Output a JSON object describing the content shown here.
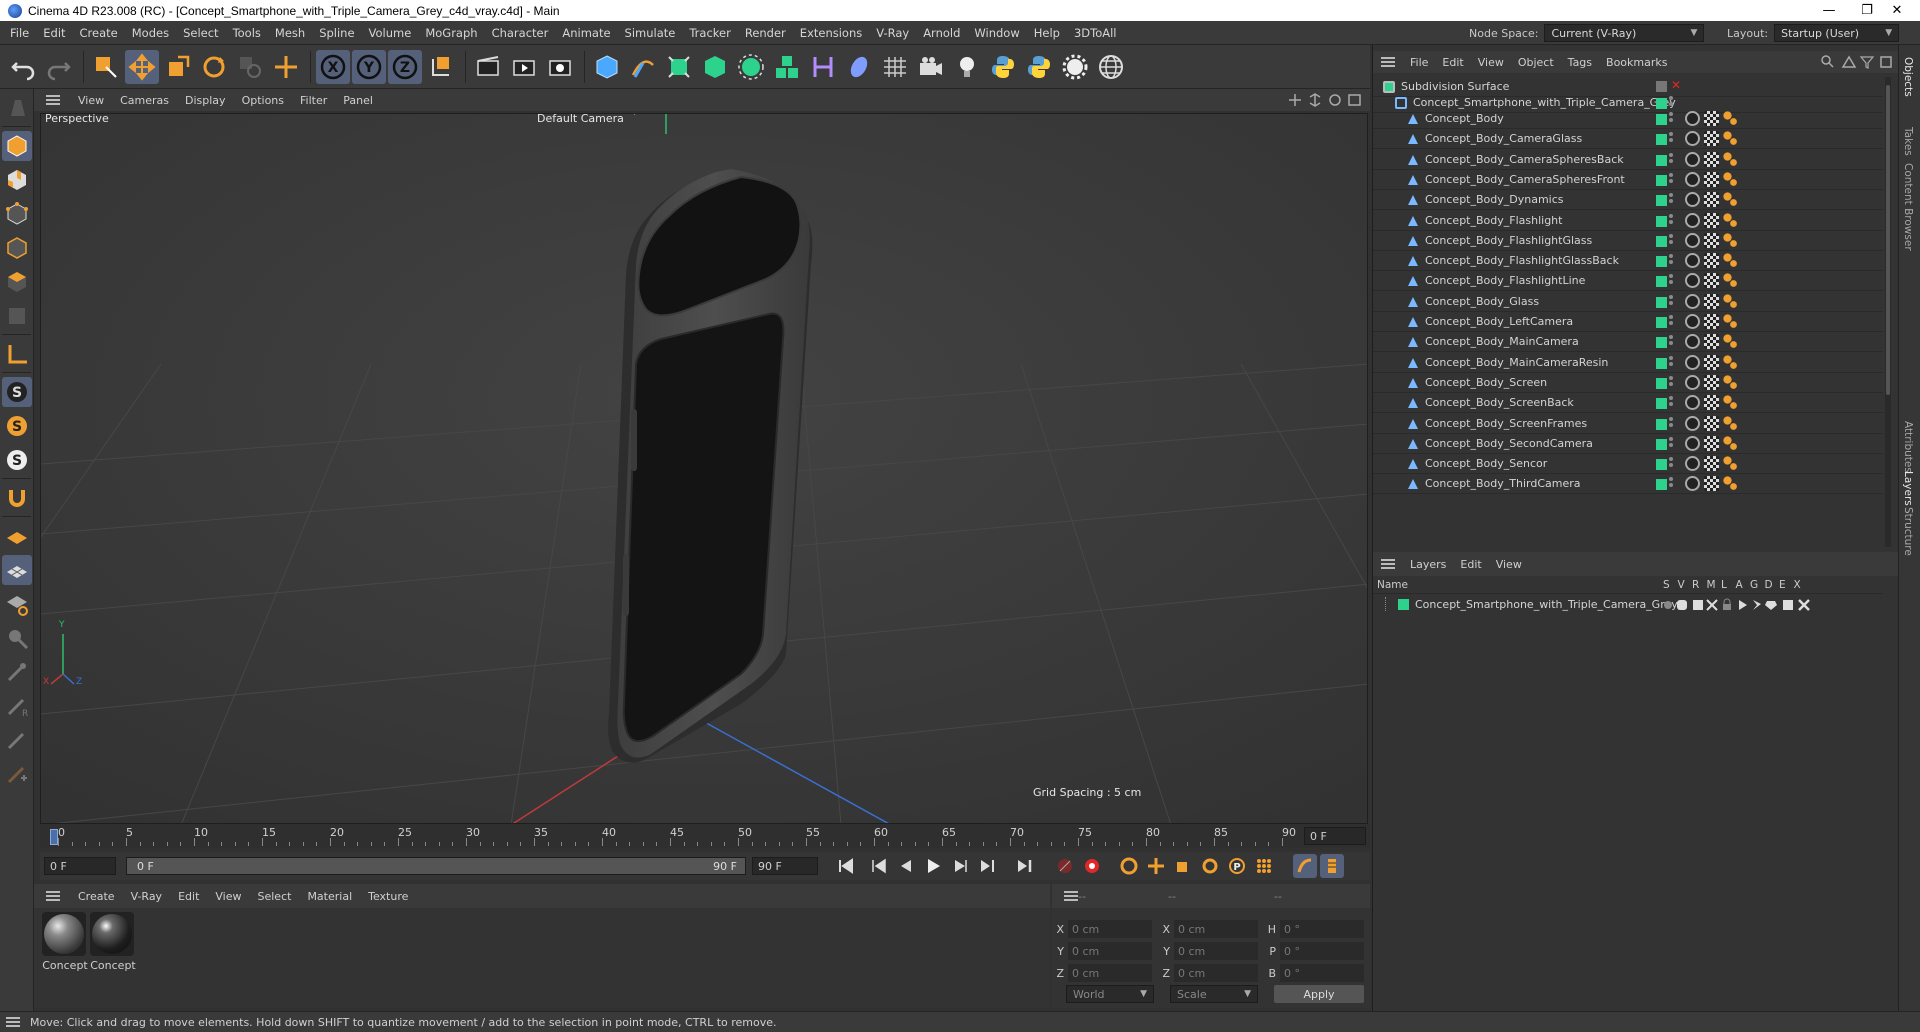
{
  "window": {
    "title": "Cinema 4D R23.008 (RC) - [Concept_Smartphone_with_Triple_Camera_Grey_c4d_vray.c4d] - Main",
    "min": "—",
    "max": "❐",
    "close": "✕"
  },
  "menubar": {
    "items": [
      "File",
      "Edit",
      "Create",
      "Modes",
      "Select",
      "Tools",
      "Mesh",
      "Spline",
      "Volume",
      "MoGraph",
      "Character",
      "Animate",
      "Simulate",
      "Tracker",
      "Render",
      "Extensions",
      "V-Ray",
      "Arnold",
      "Window",
      "Help",
      "3DToAll"
    ],
    "node_space_label": "Node Space:",
    "node_space_value": "Current (V-Ray)",
    "layout_label": "Layout:",
    "layout_value": "Startup (User)"
  },
  "viewport": {
    "menu": [
      "View",
      "Cameras",
      "Display",
      "Options",
      "Filter",
      "Panel"
    ],
    "projection": "Perspective",
    "camera": "Default Camera",
    "camera_suffix": "·°",
    "grid_spacing": "Grid Spacing : 5 cm",
    "axis_x": "X",
    "axis_y": "Y",
    "axis_z": "Z"
  },
  "timeline": {
    "ticks": [
      "0",
      "5",
      "10",
      "15",
      "20",
      "25",
      "30",
      "35",
      "40",
      "45",
      "50",
      "55",
      "60",
      "65",
      "70",
      "75",
      "80",
      "85",
      "90"
    ],
    "current_frame": "0 F",
    "start_field": "0 F",
    "range_start": "0 F",
    "range_end": "90 F",
    "end_field": "90 F"
  },
  "materials": {
    "menu": [
      "Create",
      "V-Ray",
      "Edit",
      "View",
      "Select",
      "Material",
      "Texture"
    ],
    "items": [
      {
        "label": "Concept"
      },
      {
        "label": "Concept"
      }
    ]
  },
  "coordinates": {
    "header_a": "--",
    "header_b": "--",
    "header_c": "--",
    "rows": [
      {
        "a": "X",
        "a_val": "0 cm",
        "b": "X",
        "b_val": "0 cm",
        "c": "H",
        "c_val": "0 °"
      },
      {
        "a": "Y",
        "a_val": "0 cm",
        "b": "Y",
        "b_val": "0 cm",
        "c": "P",
        "c_val": "0 °"
      },
      {
        "a": "Z",
        "a_val": "0 cm",
        "b": "Z",
        "b_val": "0 cm",
        "c": "B",
        "c_val": "0 °"
      }
    ],
    "space": "World",
    "mode": "Scale",
    "apply": "Apply"
  },
  "status": {
    "message": "Move: Click and drag to move elements. Hold down SHIFT to quantize movement / add to the selection in point mode, CTRL to remove."
  },
  "object_manager": {
    "menu": [
      "File",
      "Edit",
      "View",
      "Object",
      "Tags",
      "Bookmarks"
    ],
    "root": "Subdivision Surface",
    "group": "Concept_Smartphone_with_Triple_Camera_Grey",
    "objects": [
      "Concept_Body",
      "Concept_Body_CameraGlass",
      "Concept_Body_CameraSpheresBack",
      "Concept_Body_CameraSpheresFront",
      "Concept_Body_Dynamics",
      "Concept_Body_Flashlight",
      "Concept_Body_FlashlightGlass",
      "Concept_Body_FlashlightGlassBack",
      "Concept_Body_FlashlightLine",
      "Concept_Body_Glass",
      "Concept_Body_LeftCamera",
      "Concept_Body_MainCamera",
      "Concept_Body_MainCameraResin",
      "Concept_Body_Screen",
      "Concept_Body_ScreenBack",
      "Concept_Body_ScreenFrames",
      "Concept_Body_SecondCamera",
      "Concept_Body_Sencor",
      "Concept_Body_ThirdCamera"
    ]
  },
  "layers": {
    "menu": [
      "Layers",
      "Edit",
      "View"
    ],
    "columns": [
      "Name",
      "S",
      "V",
      "R",
      "M",
      "L",
      "A",
      "G",
      "D",
      "E",
      "X"
    ],
    "rows": [
      {
        "name": "Concept_Smartphone_with_Triple_Camera_Grey",
        "color": "#2dd38c"
      }
    ]
  },
  "side_tabs": [
    "Objects",
    "Takes",
    "Content Browser",
    "Attributes",
    "Layers",
    "Structure"
  ],
  "colors": {
    "accent_active": "#55607a",
    "layer_green": "#2dd38c",
    "icon_orange": "#f0a030",
    "icon_blue": "#4aa8ff"
  }
}
